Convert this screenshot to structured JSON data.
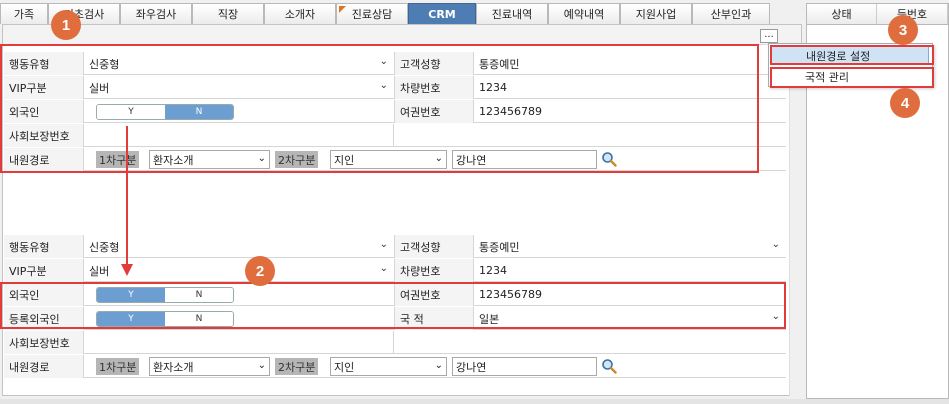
{
  "tabs": [
    {
      "label": "가족",
      "active": false
    },
    {
      "label": "기초검사",
      "active": false
    },
    {
      "label": "좌우검사",
      "active": false
    },
    {
      "label": "직장",
      "active": false
    },
    {
      "label": "소개자",
      "active": false
    },
    {
      "label": "진료상담",
      "active": false,
      "flag": true
    },
    {
      "label": "CRM",
      "active": true
    },
    {
      "label": "진료내역",
      "active": false
    },
    {
      "label": "예약내역",
      "active": false
    },
    {
      "label": "지원사업",
      "active": false
    },
    {
      "label": "산부인과",
      "active": false
    }
  ],
  "right_panel": {
    "col1": "상태",
    "col2": "등번호"
  },
  "more_button": "...",
  "popup_menu": {
    "item1": "내원경로 설정",
    "item2": "국적 관리"
  },
  "badges": {
    "b1": "1",
    "b2": "2",
    "b3": "3",
    "b4": "4"
  },
  "form_a": {
    "behavior_label": "행동유형",
    "behavior_value": "신중형",
    "customer_label": "고객성향",
    "customer_value": "통증예민",
    "vip_label": "VIP구분",
    "vip_value": "실버",
    "vehicle_label": "차량번호",
    "vehicle_value": "1234",
    "foreigner_label": "외국인",
    "toggle_y": "Y",
    "toggle_n": "N",
    "passport_label": "여권번호",
    "passport_value": "123456789",
    "ssn_label": "사회보장번호",
    "route_label": "내원경로",
    "first_cat_label": "1차구분",
    "first_cat_value": "환자소개",
    "second_cat_label": "2차구분",
    "second_cat_value": "지인",
    "referrer_value": "강나연"
  },
  "form_b": {
    "behavior_label": "행동유형",
    "behavior_value": "신중형",
    "customer_label": "고객성향",
    "customer_value": "통증예민",
    "vip_label": "VIP구분",
    "vip_value": "실버",
    "vehicle_label": "차량번호",
    "vehicle_value": "1234",
    "foreigner_label": "외국인",
    "toggle_y": "Y",
    "toggle_n": "N",
    "passport_label": "여권번호",
    "passport_value": "123456789",
    "reg_foreigner_label": "등록외국인",
    "nationality_label": "국 적",
    "nationality_value": "일본",
    "ssn_label": "사회보장번호",
    "route_label": "내원경로",
    "first_cat_label": "1차구분",
    "first_cat_value": "환자소개",
    "second_cat_label": "2차구분",
    "second_cat_value": "지인",
    "referrer_value": "강나연"
  },
  "colors": {
    "accent": "#4e7db3",
    "highlight": "#e23b3b",
    "badge": "#e06d3d",
    "toggle_on": "#6d9ed1"
  },
  "icons": {
    "search": "search-icon",
    "chevron": "chevron-down-icon"
  }
}
